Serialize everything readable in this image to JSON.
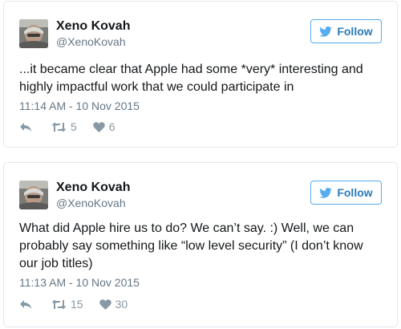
{
  "colors": {
    "accent": "#55acee",
    "follow_text": "#2b7bb9",
    "muted": "#657786",
    "icon": "#8899a6",
    "border": "#e1e8ed"
  },
  "tweets": [
    {
      "author": {
        "name": "Xeno Kovah",
        "handle": "@XenoKovah",
        "avatar": "avatar-photo"
      },
      "follow_label": "Follow",
      "text": "...it became clear that Apple had some *very* interesting and highly impactful work that we could participate in",
      "timestamp": "11:14 AM - 10 Nov 2015",
      "retweets": "5",
      "likes": "6"
    },
    {
      "author": {
        "name": "Xeno Kovah",
        "handle": "@XenoKovah",
        "avatar": "avatar-photo"
      },
      "follow_label": "Follow",
      "text": "What did Apple hire us to do? We can’t say. :) Well, we can probably say something like “low level security” (I don’t know our job titles)",
      "timestamp": "11:13 AM - 10 Nov 2015",
      "retweets": "15",
      "likes": "30"
    }
  ],
  "icons": {
    "follow": "twitter-bird-icon",
    "reply": "reply-icon",
    "retweet": "retweet-icon",
    "like": "heart-icon"
  }
}
